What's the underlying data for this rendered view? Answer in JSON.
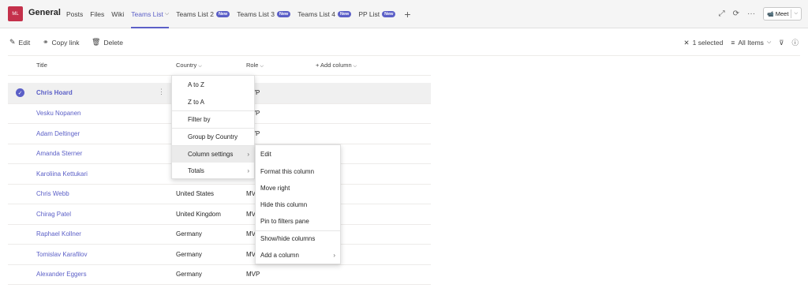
{
  "team": {
    "avatar": "ML",
    "name": "General"
  },
  "tabs": [
    {
      "label": "Posts"
    },
    {
      "label": "Files"
    },
    {
      "label": "Wiki"
    },
    {
      "label": "Teams List",
      "active": true,
      "chevron": "⌵"
    },
    {
      "label": "Teams List 2",
      "badge": "New"
    },
    {
      "label": "Teams List 3",
      "badge": "New"
    },
    {
      "label": "Teams List 4",
      "badge": "New"
    },
    {
      "label": "PP List",
      "badge": "New"
    }
  ],
  "topright": {
    "expand_icon": "⤢",
    "refresh_icon": "⟳",
    "more_icon": "···",
    "meet_label": "Meet",
    "meet_icon": "📹",
    "meet_chevron": "⌵"
  },
  "commands": {
    "edit": "Edit",
    "copy_link": "Copy link",
    "delete": "Delete",
    "selected": "1 selected",
    "view": "All Items",
    "clear_icon": "✕",
    "view_icon": "≡",
    "view_chevron": "⌵",
    "filter_icon": "⊽",
    "info_icon": "ⓘ"
  },
  "columns": {
    "title": "Title",
    "country": "Country",
    "role": "Role",
    "add": "+ Add column",
    "chevron": "⌵"
  },
  "rows": [
    {
      "title": "Chris Hoard",
      "country": "",
      "role": "MVP",
      "selected": true
    },
    {
      "title": "Vesku Nopanen",
      "country": "",
      "role": "MVP"
    },
    {
      "title": "Adam Deltinger",
      "country": "",
      "role": "MVP"
    },
    {
      "title": "Amanda Sterner",
      "country": "",
      "role": ""
    },
    {
      "title": "Karoliina Kettukari",
      "country": "",
      "role": ""
    },
    {
      "title": "Chris Webb",
      "country": "United States",
      "role": "MVP"
    },
    {
      "title": "Chirag Patel",
      "country": "United Kingdom",
      "role": "MV"
    },
    {
      "title": "Raphael Kollner",
      "country": "Germany",
      "role": "MV"
    },
    {
      "title": "Tomislav Karafilov",
      "country": "Germany",
      "role": "MV"
    },
    {
      "title": "Alexander Eggers",
      "country": "Germany",
      "role": "MVP"
    }
  ],
  "menu_column": [
    {
      "label": "A to Z"
    },
    {
      "label": "Z to A"
    },
    {
      "label": "Filter by"
    },
    {
      "label": "Group by Country"
    },
    {
      "label": "Column settings",
      "submenu": true,
      "highlight": true
    },
    {
      "label": "Totals",
      "submenu": true
    }
  ],
  "menu_settings": [
    {
      "label": "Edit"
    },
    {
      "label": "Format this column"
    },
    {
      "label": "Move right"
    },
    {
      "label": "Hide this column"
    },
    {
      "label": "Pin to filters pane"
    },
    {
      "label": "Show/hide columns"
    },
    {
      "label": "Add a column",
      "submenu": true
    }
  ],
  "colors": {
    "accent": "#5b5fc7",
    "avatar_bg": "#c4314b"
  }
}
